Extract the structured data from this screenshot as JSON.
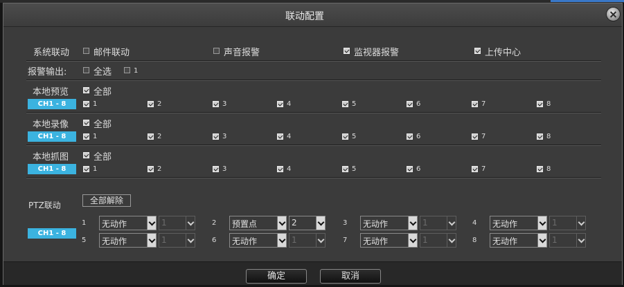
{
  "window": {
    "title": "联动配置"
  },
  "system_link": {
    "label": "系统联动",
    "options": [
      {
        "label": "邮件联动",
        "checked": false
      },
      {
        "label": "声音报警",
        "checked": false
      },
      {
        "label": "监视器报警",
        "checked": true
      },
      {
        "label": "上传中心",
        "checked": true
      }
    ]
  },
  "alarm_output": {
    "label": "报警输出:",
    "select_all": {
      "label": "全选",
      "checked": false
    },
    "outputs": [
      {
        "label": "1",
        "checked": false
      }
    ]
  },
  "sections": [
    {
      "label": "本地预览",
      "all_label": "全部",
      "all_checked": true,
      "channel_range": "CH1 - 8",
      "channels": [
        {
          "label": "1",
          "checked": true
        },
        {
          "label": "2",
          "checked": true
        },
        {
          "label": "3",
          "checked": true
        },
        {
          "label": "4",
          "checked": true
        },
        {
          "label": "5",
          "checked": true
        },
        {
          "label": "6",
          "checked": true
        },
        {
          "label": "7",
          "checked": true
        },
        {
          "label": "8",
          "checked": true
        }
      ]
    },
    {
      "label": "本地录像",
      "all_label": "全部",
      "all_checked": true,
      "channel_range": "CH1 - 8",
      "channels": [
        {
          "label": "1",
          "checked": true
        },
        {
          "label": "2",
          "checked": true
        },
        {
          "label": "3",
          "checked": true
        },
        {
          "label": "4",
          "checked": true
        },
        {
          "label": "5",
          "checked": true
        },
        {
          "label": "6",
          "checked": true
        },
        {
          "label": "7",
          "checked": true
        },
        {
          "label": "8",
          "checked": true
        }
      ]
    },
    {
      "label": "本地抓图",
      "all_label": "全部",
      "all_checked": true,
      "channel_range": "CH1 - 8",
      "channels": [
        {
          "label": "1",
          "checked": true
        },
        {
          "label": "2",
          "checked": true
        },
        {
          "label": "3",
          "checked": true
        },
        {
          "label": "4",
          "checked": true
        },
        {
          "label": "5",
          "checked": true
        },
        {
          "label": "6",
          "checked": true
        },
        {
          "label": "7",
          "checked": true
        },
        {
          "label": "8",
          "checked": true
        }
      ]
    }
  ],
  "ptz": {
    "label": "PTZ联动",
    "release_all": "全部解除",
    "channel_range": "CH1 - 8",
    "channels": [
      {
        "label": "1",
        "action": "无动作",
        "value": "1",
        "value_enabled": false
      },
      {
        "label": "2",
        "action": "预置点",
        "value": "2",
        "value_enabled": true
      },
      {
        "label": "3",
        "action": "无动作",
        "value": "1",
        "value_enabled": false
      },
      {
        "label": "4",
        "action": "无动作",
        "value": "1",
        "value_enabled": false
      },
      {
        "label": "5",
        "action": "无动作",
        "value": "1",
        "value_enabled": false
      },
      {
        "label": "6",
        "action": "无动作",
        "value": "1",
        "value_enabled": false
      },
      {
        "label": "7",
        "action": "无动作",
        "value": "1",
        "value_enabled": false
      },
      {
        "label": "8",
        "action": "无动作",
        "value": "1",
        "value_enabled": false
      }
    ]
  },
  "footer": {
    "ok": "确定",
    "cancel": "取消"
  },
  "colors": {
    "accent": "#3bb3e0",
    "background": "#3b3b3b"
  }
}
